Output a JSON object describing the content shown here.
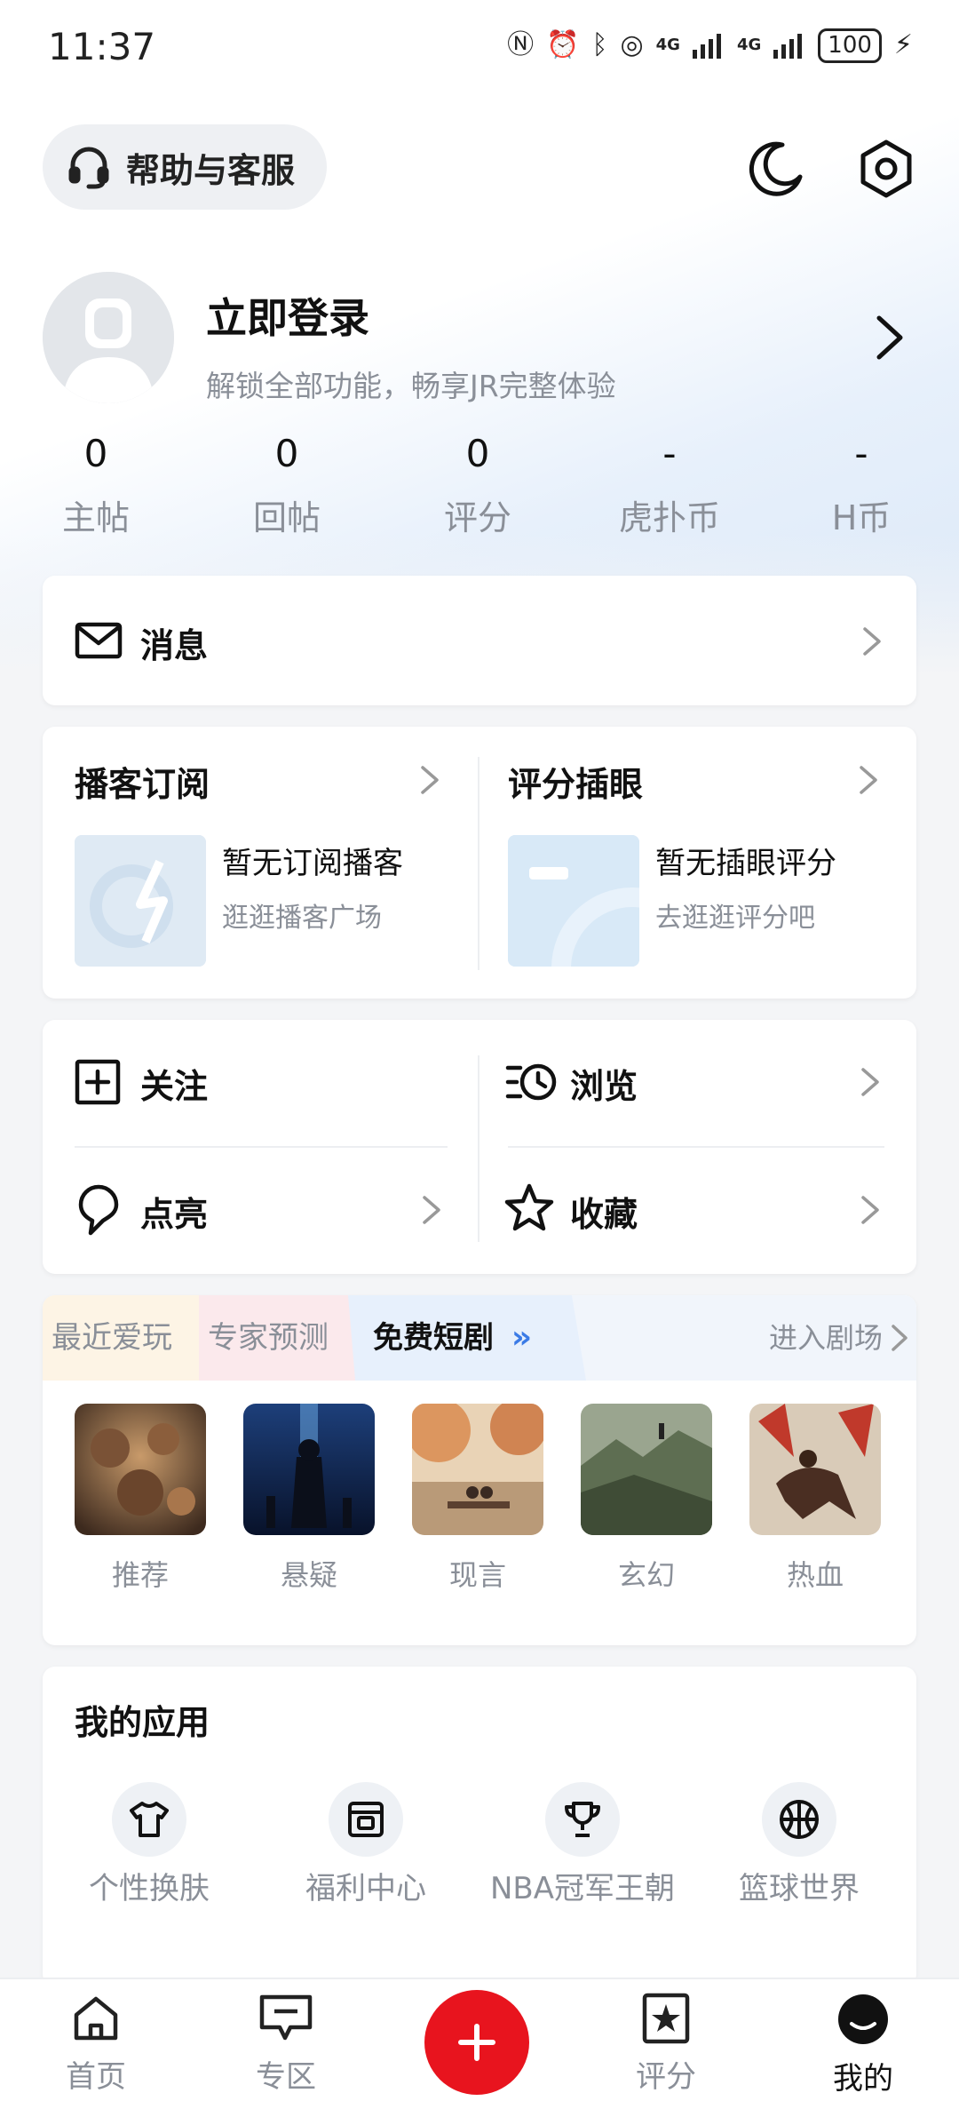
{
  "status_bar": {
    "time": "11:37",
    "network_label": "4G",
    "battery": "100"
  },
  "header": {
    "help_label": "帮助与客服",
    "icons": [
      "headset-icon",
      "moon-icon",
      "settings-hex-icon"
    ]
  },
  "profile": {
    "login_title": "立即登录",
    "login_subtitle": "解锁全部功能，畅享JR完整体验",
    "stats": [
      {
        "value": "0",
        "label": "主帖"
      },
      {
        "value": "0",
        "label": "回帖"
      },
      {
        "value": "0",
        "label": "评分"
      },
      {
        "value": "-",
        "label": "虎扑币"
      },
      {
        "value": "-",
        "label": "H币"
      }
    ]
  },
  "messages": {
    "label": "消息"
  },
  "subscriptions": {
    "podcast": {
      "title": "播客订阅",
      "empty_title": "暂无订阅播客",
      "empty_sub": "逛逛播客广场"
    },
    "rating": {
      "title": "评分插眼",
      "empty_title": "暂无插眼评分",
      "empty_sub": "去逛逛评分吧"
    }
  },
  "grid": {
    "follow": "关注",
    "browse": "浏览",
    "highlight": "点亮",
    "favorites": "收藏"
  },
  "drama": {
    "tabs": [
      "最近爱玩",
      "专家预测",
      "免费短剧"
    ],
    "active_tab": "免费短剧",
    "enter_theater": "进入剧场",
    "genres": [
      "推荐",
      "悬疑",
      "现言",
      "玄幻",
      "热血"
    ]
  },
  "apps": {
    "title": "我的应用",
    "items": [
      {
        "label": "个性换肤",
        "icon": "tshirt-icon"
      },
      {
        "label": "福利中心",
        "icon": "gift-box-icon"
      },
      {
        "label": "NBA冠军王朝",
        "icon": "trophy-icon"
      },
      {
        "label": "篮球世界",
        "icon": "basketball-icon"
      }
    ]
  },
  "bottom_nav": {
    "items": [
      {
        "label": "首页",
        "icon": "home-icon"
      },
      {
        "label": "专区",
        "icon": "zone-icon"
      },
      {
        "label": "",
        "icon": "plus-icon"
      },
      {
        "label": "评分",
        "icon": "rating-star-icon"
      },
      {
        "label": "我的",
        "icon": "me-icon"
      }
    ],
    "active": "我的"
  },
  "colors": {
    "accent_red": "#e8141e",
    "text_primary": "#111111",
    "text_secondary": "#8a8f98"
  }
}
